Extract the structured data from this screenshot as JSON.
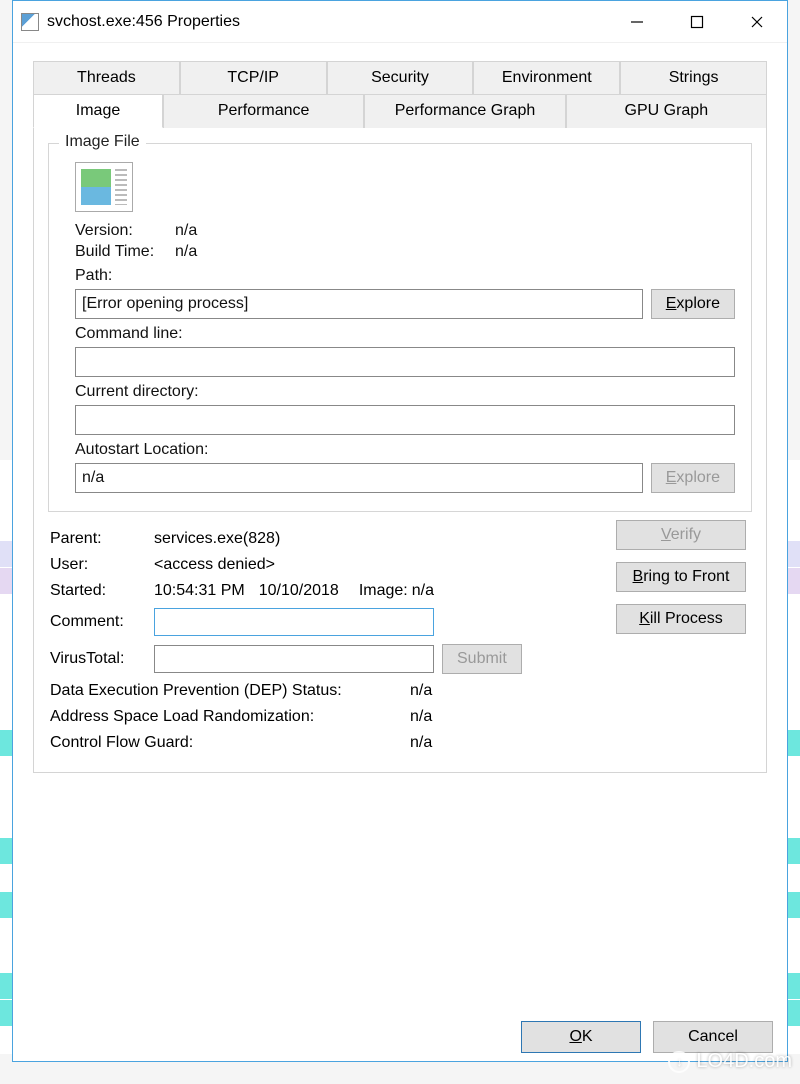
{
  "window": {
    "title": "svchost.exe:456 Properties"
  },
  "tabs": {
    "row1": [
      "Threads",
      "TCP/IP",
      "Security",
      "Environment",
      "Strings"
    ],
    "row2": [
      "Image",
      "Performance",
      "Performance Graph",
      "GPU Graph"
    ],
    "active": "Image"
  },
  "imageFile": {
    "groupTitle": "Image File",
    "version_label": "Version:",
    "version_value": "n/a",
    "buildtime_label": "Build Time:",
    "buildtime_value": "n/a",
    "path_label": "Path:",
    "path_value": "[Error opening process]",
    "explore1": "Explore",
    "cmdline_label": "Command line:",
    "cmdline_value": "",
    "curdir_label": "Current directory:",
    "curdir_value": "",
    "autostart_label": "Autostart Location:",
    "autostart_value": "n/a",
    "explore2": "Explore"
  },
  "details": {
    "parent_label": "Parent:",
    "parent_value": "services.exe(828)",
    "user_label": "User:",
    "user_value": "<access denied>",
    "started_label": "Started:",
    "started_time": "10:54:31 PM",
    "started_date": "10/10/2018",
    "image_label": "Image:",
    "image_value": "n/a",
    "comment_label": "Comment:",
    "comment_value": "",
    "vt_label": "VirusTotal:",
    "vt_value": "",
    "submit": "Submit",
    "dep_label": "Data Execution Prevention (DEP) Status:",
    "dep_value": "n/a",
    "aslr_label": "Address Space Load Randomization:",
    "aslr_value": "n/a",
    "cfg_label": "Control Flow Guard:",
    "cfg_value": "n/a"
  },
  "buttons": {
    "verify": "Verify",
    "bring_front": "Bring to Front",
    "kill": "Kill Process",
    "ok": "OK",
    "cancel": "Cancel"
  },
  "watermark": "LO4D.com"
}
